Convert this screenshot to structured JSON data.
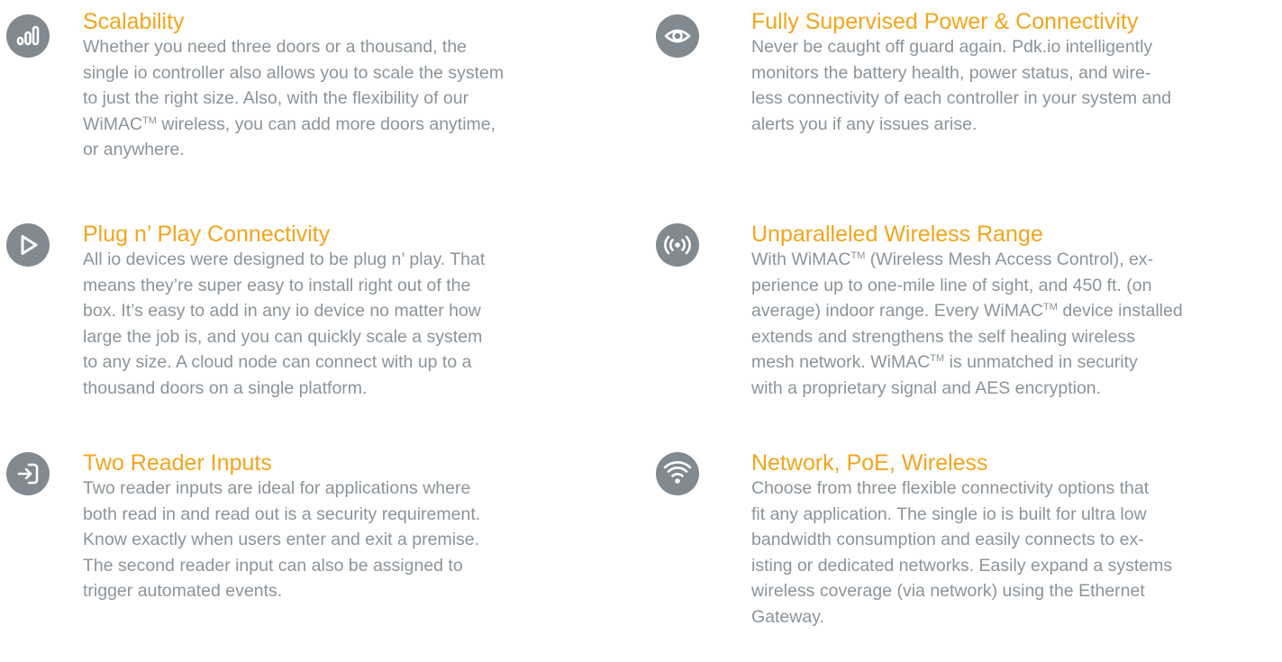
{
  "left_features": [
    {
      "icon": "signal-bars-icon",
      "title": "Scalability",
      "lines": [
        "Whether you need three doors or a thousand, the",
        "single io controller also allows you to scale the system",
        "to just the right size. Also, with the flexibility of our",
        "WiMAC™ wireless, you can add more doors anytime,",
        "or anywhere."
      ]
    },
    {
      "icon": "play-icon",
      "title": "Plug n’ Play Connectivity",
      "lines": [
        "All io devices were designed to be plug n’ play. That",
        "means they’re super easy to install right out of the",
        "box. It’s easy to add in any io device no matter how",
        "large the job is, and you can quickly scale a system",
        "to any size. A cloud node can connect with up to a",
        "thousand doors on a single platform."
      ]
    },
    {
      "icon": "sign-in-icon",
      "title": "Two Reader Inputs",
      "lines": [
        "Two reader inputs are ideal for applications where",
        "both read in and read out is a security requirement.",
        "Know exactly when users enter and exit a premise.",
        "The second reader input can also be assigned to",
        "trigger automated events."
      ]
    }
  ],
  "right_features": [
    {
      "icon": "eye-icon",
      "title": "Fully Supervised Power & Connectivity",
      "lines": [
        "Never be caught off guard again. Pdk.io intelligently",
        "monitors the battery health, power status, and wire-",
        "less connectivity of each controller in your system and",
        "alerts you if any issues arise."
      ]
    },
    {
      "icon": "broadcast-icon",
      "title": "Unparalleled Wireless Range",
      "lines": [
        "With WiMAC™ (Wireless Mesh Access Control), ex-",
        "perience up to one-mile line of sight, and 450 ft. (on",
        "average) indoor range. Every WiMAC™ device installed",
        "extends and strengthens the self healing wireless",
        "mesh network. WiMAC™ is unmatched in security",
        "with a proprietary signal and AES encryption."
      ]
    },
    {
      "icon": "wifi-icon",
      "title": "Network, PoE, Wireless",
      "lines": [
        "Choose from three flexible connectivity options that",
        "fit any application. The single io is built for ultra low",
        "bandwidth consumption and easily connects to ex-",
        "isting or dedicated networks. Easily expand a systems",
        "wireless coverage (via network) using the Ethernet",
        "Gateway."
      ]
    }
  ]
}
